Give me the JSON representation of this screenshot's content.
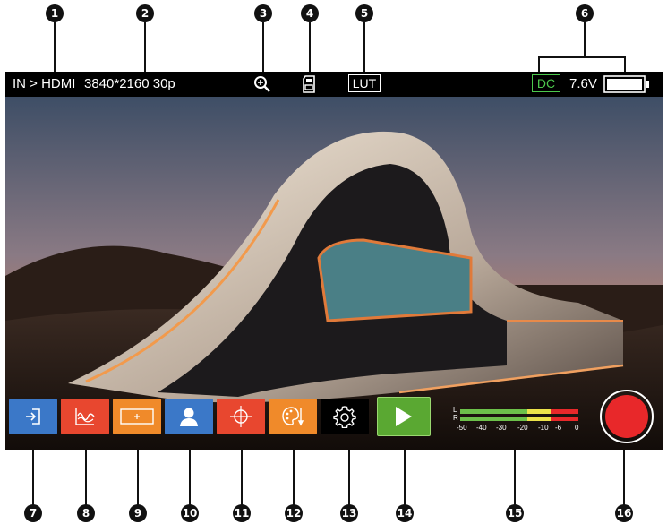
{
  "topbar": {
    "input_label": "IN > HDMI",
    "resolution": "3840*2160 30p",
    "zoom_icon": "zoom-in-icon",
    "sd_icon": "sd-card-icon",
    "lut_label": "LUT",
    "dc_label": "DC",
    "voltage": "7.6V",
    "battery_icon": "battery-icon"
  },
  "callouts": [
    "1",
    "2",
    "3",
    "4",
    "5",
    "6",
    "7",
    "8",
    "9",
    "10",
    "11",
    "12",
    "13",
    "14",
    "15",
    "16"
  ],
  "toolbar": {
    "buttons": [
      {
        "name": "input-button",
        "icon": "input-arrow-icon",
        "color": "#3b78c8"
      },
      {
        "name": "waveform-button",
        "icon": "waveform-icon",
        "color": "#e8472f"
      },
      {
        "name": "frame-guide-button",
        "icon": "frame-guide-icon",
        "color": "#f08a2a"
      },
      {
        "name": "false-color-button",
        "icon": "person-icon",
        "color": "#3b78c8"
      },
      {
        "name": "center-marker-button",
        "icon": "crosshair-icon",
        "color": "#e8472f"
      },
      {
        "name": "palette-button",
        "icon": "palette-icon",
        "color": "#f08a2a"
      },
      {
        "name": "settings-button",
        "icon": "gear-icon",
        "color": "#000000"
      },
      {
        "name": "play-button",
        "icon": "play-icon",
        "color": "#5aa832"
      },
      {
        "name": "record-button",
        "icon": "record-icon",
        "color": "#e8282a"
      }
    ],
    "audio_meter": {
      "channels": [
        "L",
        "R"
      ],
      "scale": [
        "-50",
        "-40",
        "-30",
        "-20",
        "-10",
        "-6",
        "0"
      ]
    }
  }
}
